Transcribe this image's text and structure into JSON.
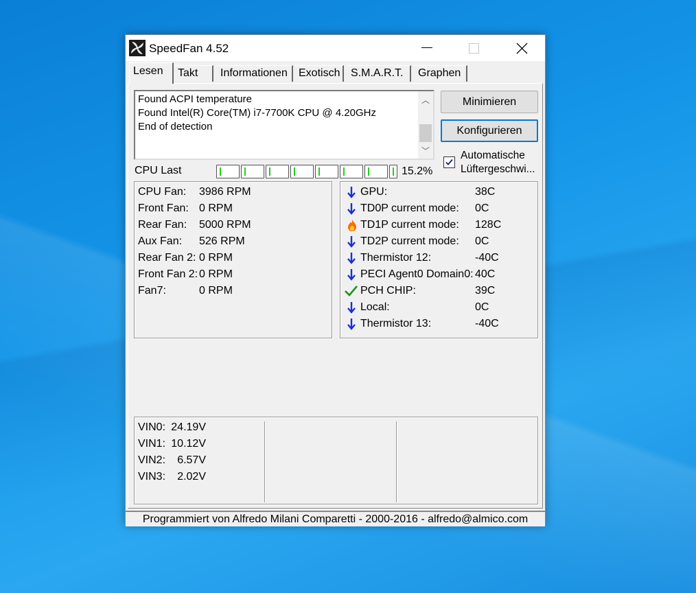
{
  "window": {
    "title": "SpeedFan 4.52"
  },
  "tabs": [
    {
      "label": "Lesen"
    },
    {
      "label": "Takt"
    },
    {
      "label": "Informationen"
    },
    {
      "label": "Exotisch"
    },
    {
      "label": "S.M.A.R.T."
    },
    {
      "label": "Graphen"
    }
  ],
  "log": {
    "lines": [
      "Found ACPI temperature",
      "Found Intel(R) Core(TM) i7-7700K CPU @ 4.20GHz",
      "End of detection"
    ]
  },
  "buttons": {
    "minimize": "Minimieren",
    "configure": "Konfigurieren"
  },
  "auto_fan": {
    "checked": true,
    "label_line1": "Automatische",
    "label_line2": "Lüftergeschwi..."
  },
  "cpu": {
    "label": "CPU Last",
    "percent": "15.2%",
    "bars": 8
  },
  "fans": [
    {
      "name": "CPU Fan:",
      "value": "3986 RPM"
    },
    {
      "name": "Front Fan:",
      "value": "0 RPM"
    },
    {
      "name": "Rear Fan:",
      "value": "5000 RPM"
    },
    {
      "name": "Aux Fan:",
      "value": "526 RPM"
    },
    {
      "name": "Rear Fan 2:",
      "value": "0 RPM"
    },
    {
      "name": "Front Fan 2:",
      "value": "0 RPM"
    },
    {
      "name": "Fan7:",
      "value": "0 RPM"
    }
  ],
  "temps": [
    {
      "icon": "arrow-down-icon",
      "name": "GPU:",
      "value": "38C"
    },
    {
      "icon": "arrow-down-icon",
      "name": "TD0P current mode:",
      "value": "0C"
    },
    {
      "icon": "flame-icon",
      "name": "TD1P current mode:",
      "value": "128C"
    },
    {
      "icon": "arrow-down-icon",
      "name": "TD2P current mode:",
      "value": "0C"
    },
    {
      "icon": "arrow-down-icon",
      "name": "Thermistor 12:",
      "value": "-40C"
    },
    {
      "icon": "arrow-down-icon",
      "name": "PECI Agent0 Domain0:",
      "value": "40C"
    },
    {
      "icon": "checkmark-icon",
      "name": "PCH CHIP:",
      "value": "39C"
    },
    {
      "icon": "arrow-down-icon",
      "name": "Local:",
      "value": "0C"
    },
    {
      "icon": "arrow-down-icon",
      "name": "Thermistor 13:",
      "value": "-40C"
    }
  ],
  "voltages": [
    {
      "name": "VIN0:",
      "value": "24.19V"
    },
    {
      "name": "VIN1:",
      "value": "10.12V"
    },
    {
      "name": "VIN2:",
      "value": "6.57V"
    },
    {
      "name": "VIN3:",
      "value": "2.02V"
    }
  ],
  "statusbar": "Programmiert von Alfredo Milani Comparetti - 2000-2016 - alfredo@almico.com",
  "colors": {
    "arrow": "#1a2fd6",
    "check": "#1f8f1f",
    "flame": "#ff6a00",
    "cpu_bar": "#1fcf1f",
    "focus": "#0078d7"
  }
}
